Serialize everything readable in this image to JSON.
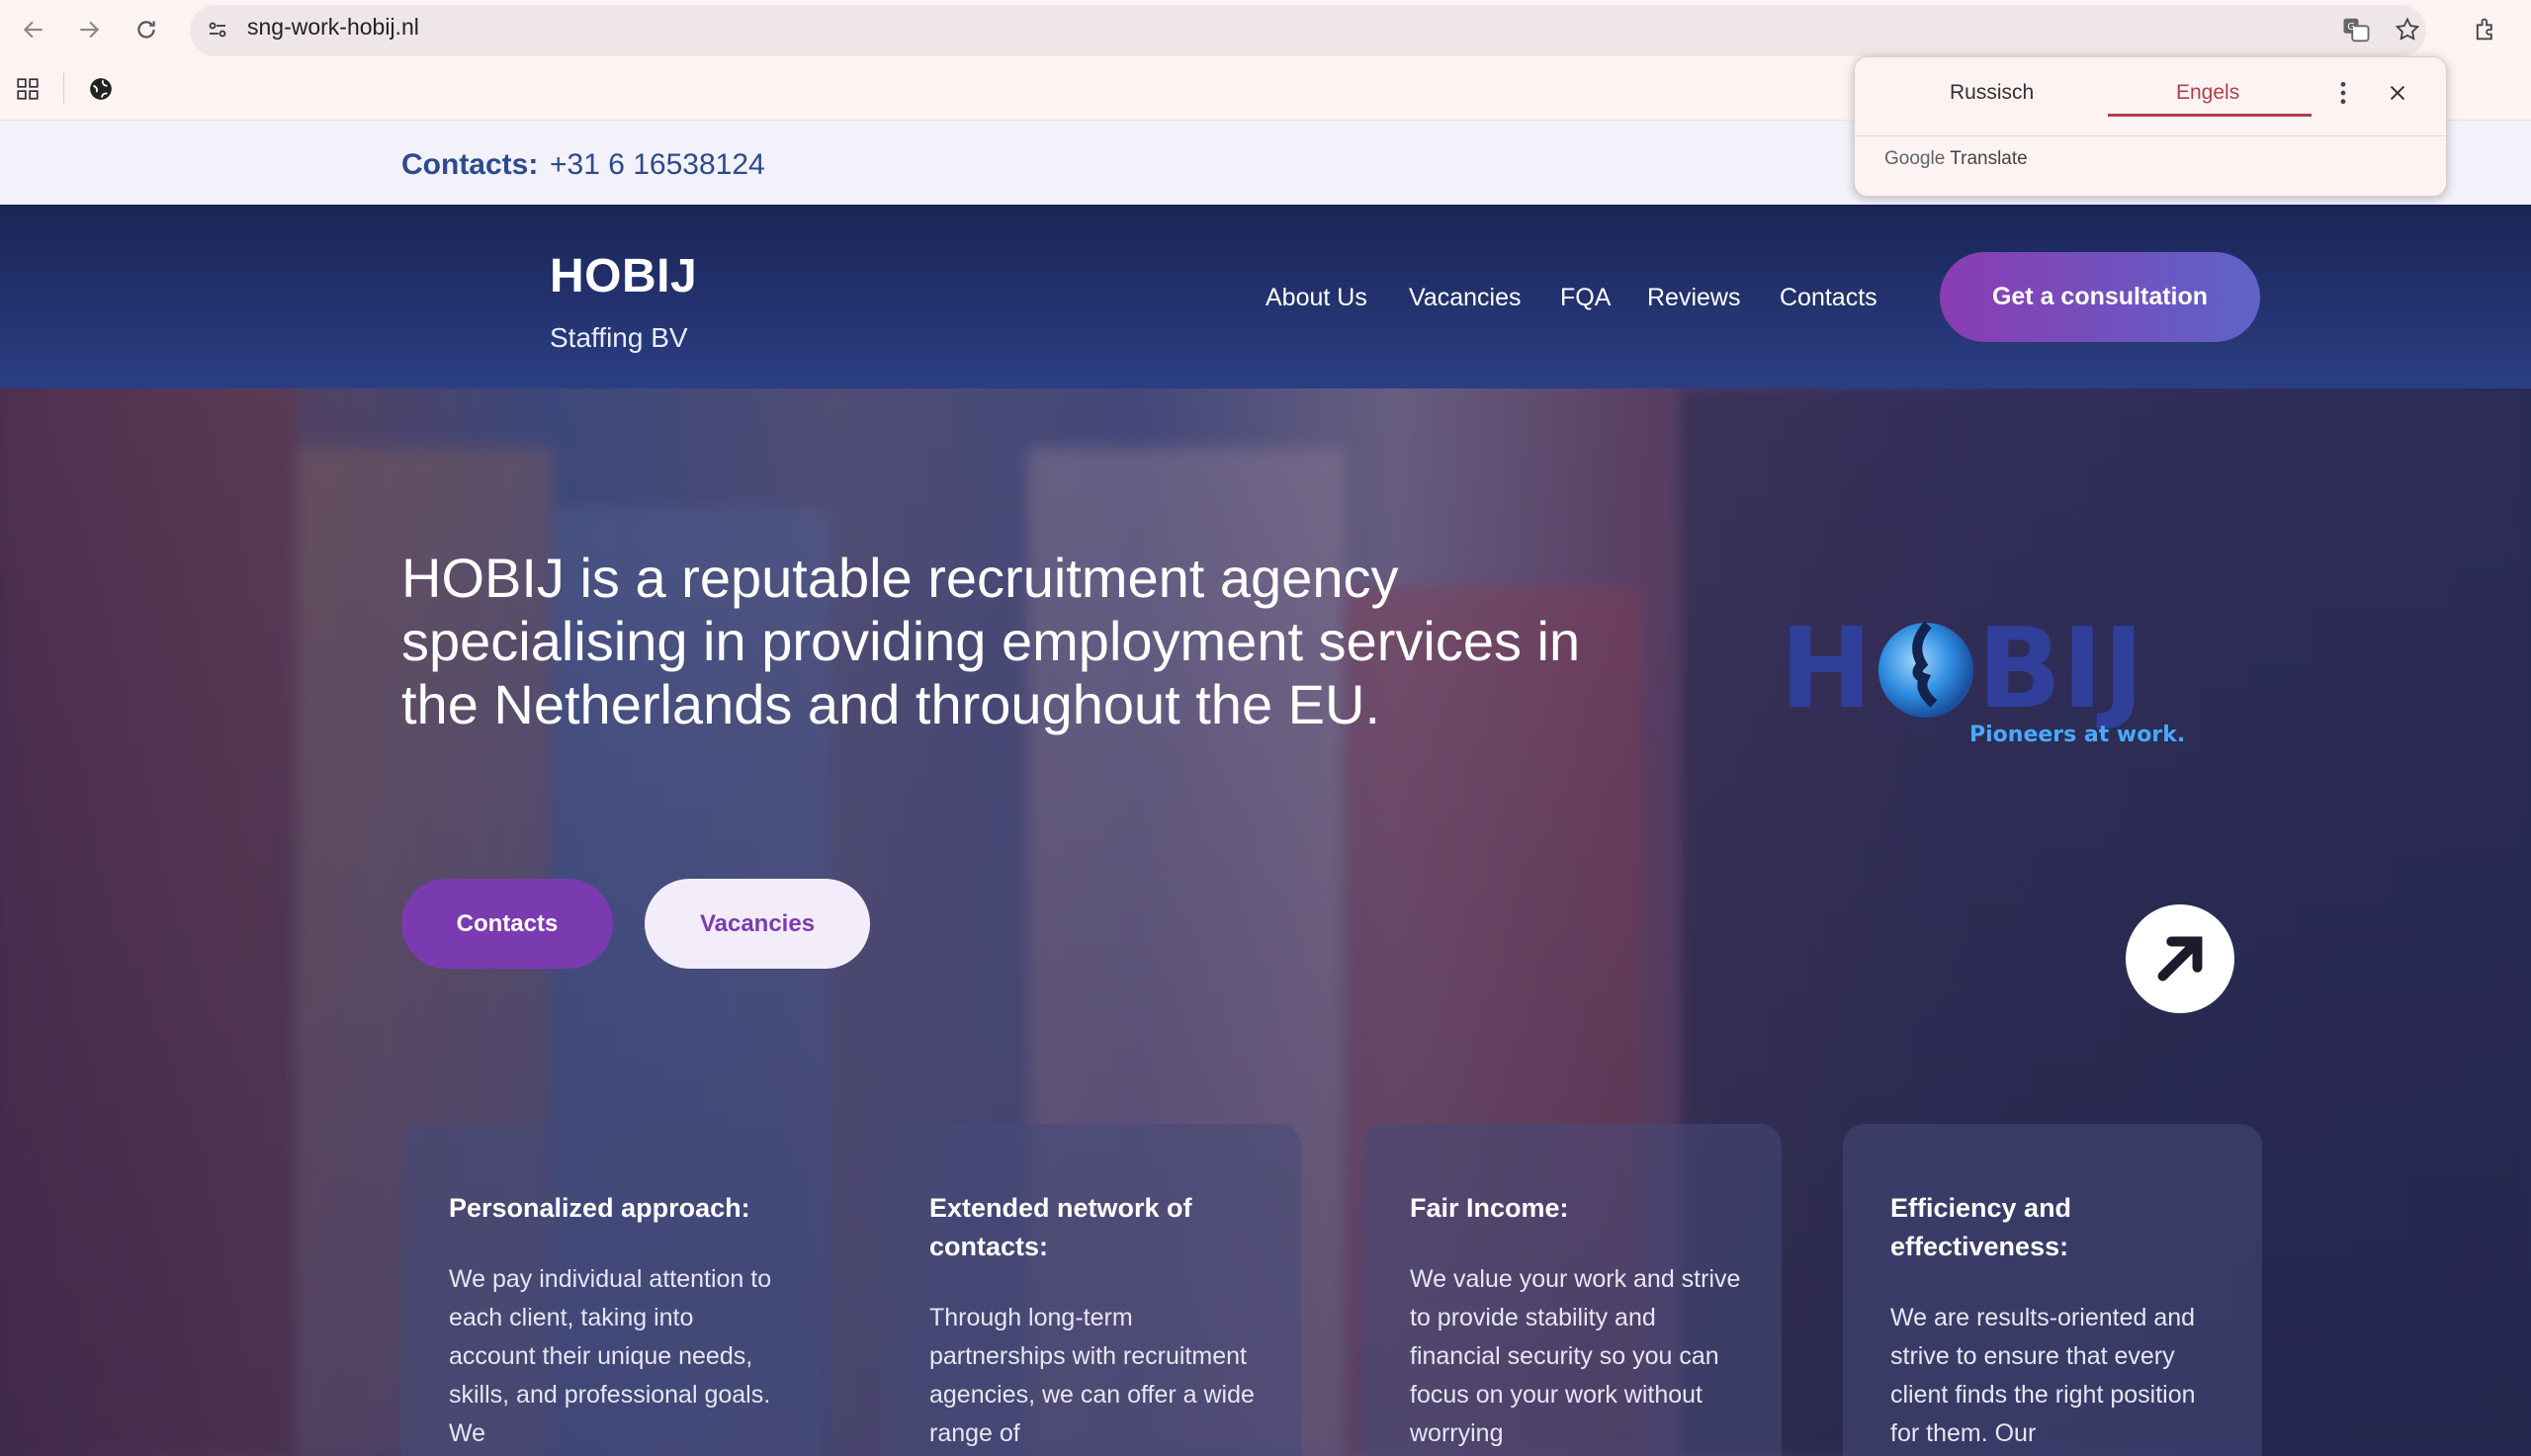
{
  "browser": {
    "url": "sng-work-hobij.nl",
    "translate_popup": {
      "tab_source": "Russisch",
      "tab_target": "Engels",
      "brand_google": "Google",
      "brand_translate": "Translate"
    }
  },
  "contact_bar": {
    "label": "Contacts:",
    "phone": "+31 6 16538124"
  },
  "header": {
    "brand_name": "HOBIJ",
    "brand_sub": "Staffing BV",
    "nav": [
      "About Us",
      "Vacancies",
      "FQA",
      "Reviews",
      "Contacts"
    ],
    "cta_label": "Get a consultation"
  },
  "hero": {
    "title": "HOBIJ is a reputable recruitment agency specialising in providing employment services in the Netherlands and throughout the EU.",
    "btn_contacts": "Contacts",
    "btn_vacancies": "Vacancies",
    "logo_text": "HOBIJ",
    "logo_tagline": "Pioneers at work."
  },
  "cards": [
    {
      "title": "Personalized approach:",
      "text": "We pay individual attention to each client, taking into account their unique needs, skills, and professional goals. We"
    },
    {
      "title": "Extended network of contacts:",
      "text": "Through long-term partnerships with recruitment agencies, we can offer a wide range of"
    },
    {
      "title": "Fair Income:",
      "text": "We value your work and strive to provide stability and financial security so you can focus on your work without worrying"
    },
    {
      "title": "Efficiency and effectiveness:",
      "text": "We are results-oriented and strive to ensure that every client finds the right position for them. Our"
    }
  ],
  "colors": {
    "brand_blue": "#2c4a8f",
    "header_navy": "#1a2556",
    "accent_purple": "#7b3bb0"
  }
}
